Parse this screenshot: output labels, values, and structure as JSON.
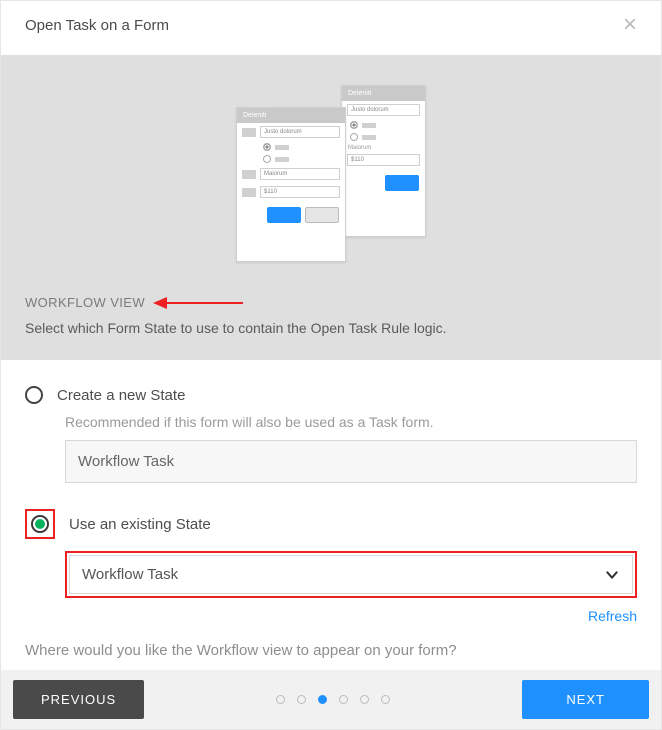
{
  "header": {
    "title": "Open Task on a Form"
  },
  "banner": {
    "heading": "WORKFLOW VIEW",
    "description": "Select which Form State to use to contain the Open Task Rule logic."
  },
  "illus": {
    "formTitle": "Deleniti",
    "field1": "Justo dolorum",
    "sect": "Maiorum",
    "price": "$110"
  },
  "options": {
    "createNew": {
      "label": "Create a new State",
      "hint": "Recommended if this form will also be used as a Task form.",
      "value": "Workflow Task",
      "selected": false
    },
    "useExisting": {
      "label": "Use an existing State",
      "value": "Workflow Task",
      "selected": true
    }
  },
  "actions": {
    "refresh": "Refresh",
    "prompt": "Where would you like the Workflow view to appear on your form?"
  },
  "footer": {
    "prev": "PREVIOUS",
    "next": "NEXT",
    "steps": 6,
    "activeStep": 3
  },
  "colors": {
    "accent": "#1E90FF",
    "highlight": "#ed2024",
    "success": "#07b35b"
  }
}
